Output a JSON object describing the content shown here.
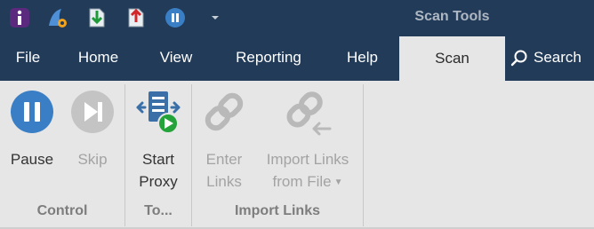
{
  "title_bar": {
    "context_title": "Scan Tools",
    "qat_icons": [
      "app-logo-icon",
      "shark-fin-icon",
      "save-down-icon",
      "save-up-icon",
      "pause-circle-icon",
      "customize-dropdown-icon"
    ]
  },
  "tabs": [
    {
      "label": "File"
    },
    {
      "label": "Home"
    },
    {
      "label": "View"
    },
    {
      "label": "Reporting"
    },
    {
      "label": "Help"
    },
    {
      "label": "Scan",
      "active": true
    }
  ],
  "search": {
    "label": "Search"
  },
  "ribbon": {
    "groups": [
      {
        "label": "Control",
        "buttons": [
          {
            "label": "Pause",
            "icon": "pause-icon",
            "enabled": true
          },
          {
            "label": "Skip",
            "icon": "skip-icon",
            "enabled": false
          }
        ]
      },
      {
        "label": "To...",
        "buttons": [
          {
            "label": "Start\nProxy",
            "icon": "proxy-play-icon",
            "enabled": true
          }
        ]
      },
      {
        "label": "Import Links",
        "buttons": [
          {
            "label": "Enter\nLinks",
            "icon": "link-icon",
            "enabled": false
          },
          {
            "label": "Import Links\nfrom File",
            "icon": "import-link-icon",
            "enabled": false,
            "dropdown": true
          }
        ]
      }
    ]
  },
  "colors": {
    "title_bar_bg": "#213b59",
    "ribbon_bg": "#e6e6e6",
    "context_accent": "#4fb848",
    "pause_blue": "#3a7fc5",
    "proxy_play_green": "#23a33a",
    "disabled_gray": "#b9b9b9"
  }
}
